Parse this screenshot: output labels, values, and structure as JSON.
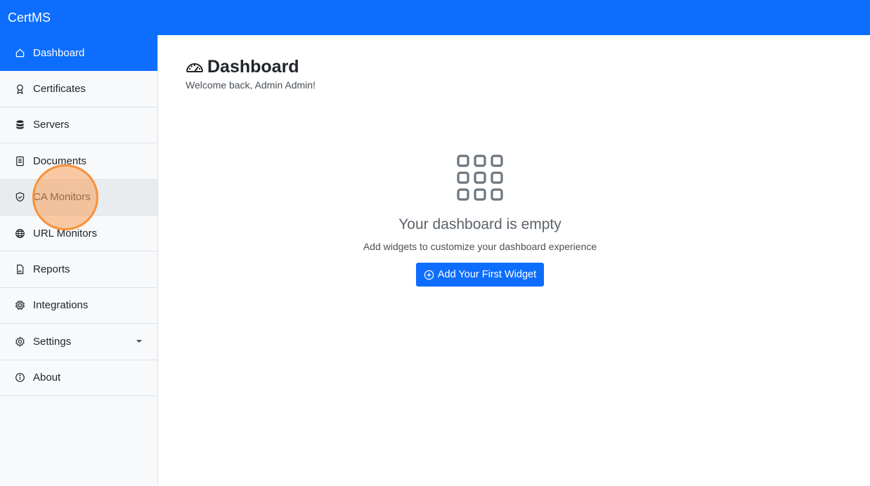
{
  "app": {
    "brand": "CertMS"
  },
  "sidebar": {
    "items": [
      {
        "label": "Dashboard",
        "icon": "house-icon"
      },
      {
        "label": "Certificates",
        "icon": "award-icon"
      },
      {
        "label": "Servers",
        "icon": "database-icon"
      },
      {
        "label": "Documents",
        "icon": "document-icon"
      },
      {
        "label": "CA Monitors",
        "icon": "shield-icon"
      },
      {
        "label": "URL Monitors",
        "icon": "globe-icon"
      },
      {
        "label": "Reports",
        "icon": "report-icon"
      },
      {
        "label": "Integrations",
        "icon": "cpu-icon"
      },
      {
        "label": "Settings",
        "icon": "gear-icon"
      },
      {
        "label": "About",
        "icon": "info-icon"
      }
    ]
  },
  "main": {
    "title": "Dashboard",
    "welcome": "Welcome back, Admin Admin!",
    "empty": {
      "title": "Your dashboard is empty",
      "subtitle": "Add widgets to customize your dashboard experience",
      "button": "Add Your First Widget"
    }
  },
  "colors": {
    "primary": "#0d6efd",
    "sidebar_bg": "#f8f9fa",
    "highlight": "#f7913a"
  }
}
